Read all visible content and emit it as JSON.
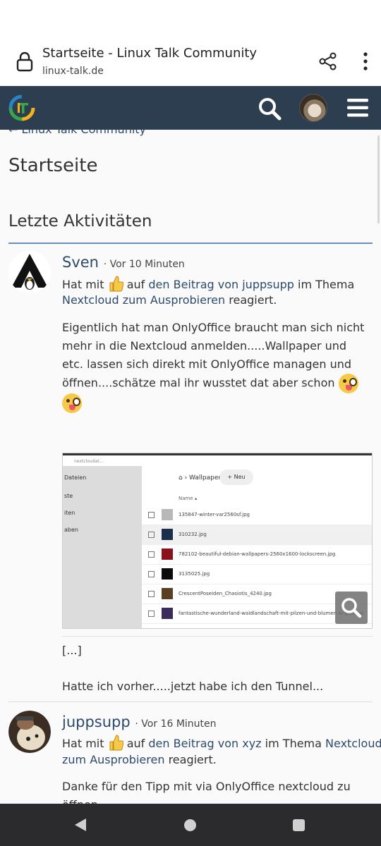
{
  "browser": {
    "title": "Startseite - Linux Talk Community",
    "domain": "linux-talk.de"
  },
  "breadcrumb": "Linux Talk Community",
  "page_title": "Startseite",
  "section_title": "Letzte Aktivitäten",
  "activities": [
    {
      "user": "Sven",
      "time": "· Vor 10 Minuten",
      "pre": "Hat mit",
      "mid": "auf",
      "link1": "den Beitrag von juppsupp",
      "mid2": "im Thema",
      "link2": "Nextcloud zum Ausprobieren",
      "post": "reagiert.",
      "body": "Eigentlich hat man OnlyOffice braucht man sich nicht mehr in die Nextcloud anmelden.....Wallpaper und etc. lassen sich direkt mit OnlyOffice managen und öffnen....schätze mal ihr wusstet dat aber schon",
      "ellipsis": "[...]",
      "cut_text": "Hatte ich vorher.....jetzt habe ich den Tunnel..."
    },
    {
      "user": "juppsupp",
      "time": "· Vor 16 Minuten",
      "pre": "Hat mit",
      "mid": "auf",
      "link1": "den Beitrag von xyz",
      "mid2": "im Thema",
      "link2a": "Nextcloud",
      "link2b": "zum Ausprobieren",
      "post": "reagiert.",
      "body": "Danke für den Tipp mit via OnlyOffice nextcloud zu öffnen."
    }
  ],
  "screenshot": {
    "tab": "nextcloudat...",
    "sidebar": [
      "Dateien",
      "ste",
      "iten",
      "aben"
    ],
    "crumb": "Wallpaper",
    "new_label": "+ Neu",
    "header": "Name ▴",
    "files": [
      {
        "name": "135847-winter-var2560sf.jpg",
        "color": "#b8b8b8"
      },
      {
        "name": "310232.jpg",
        "color": "#1b2f4a"
      },
      {
        "name": "782102-beautiful-debian-wallpapers-2560x1600-lockscreen.jpg",
        "color": "#8a1218"
      },
      {
        "name": "3135025.jpg",
        "color": "#0b0b0b"
      },
      {
        "name": "CrescentPoseiden_Chasiotis_4240.jpg",
        "color": "#5a4020"
      },
      {
        "name": "fantastische-wunderland-waldlandschaft-mit-pilzen-und-blumen-ai-generat",
        "color": "#3a2b5a"
      }
    ]
  },
  "colors": {
    "navbar": "#2c3e50",
    "link": "#2c4a6c",
    "accent_rule": "#6b8fb8"
  }
}
